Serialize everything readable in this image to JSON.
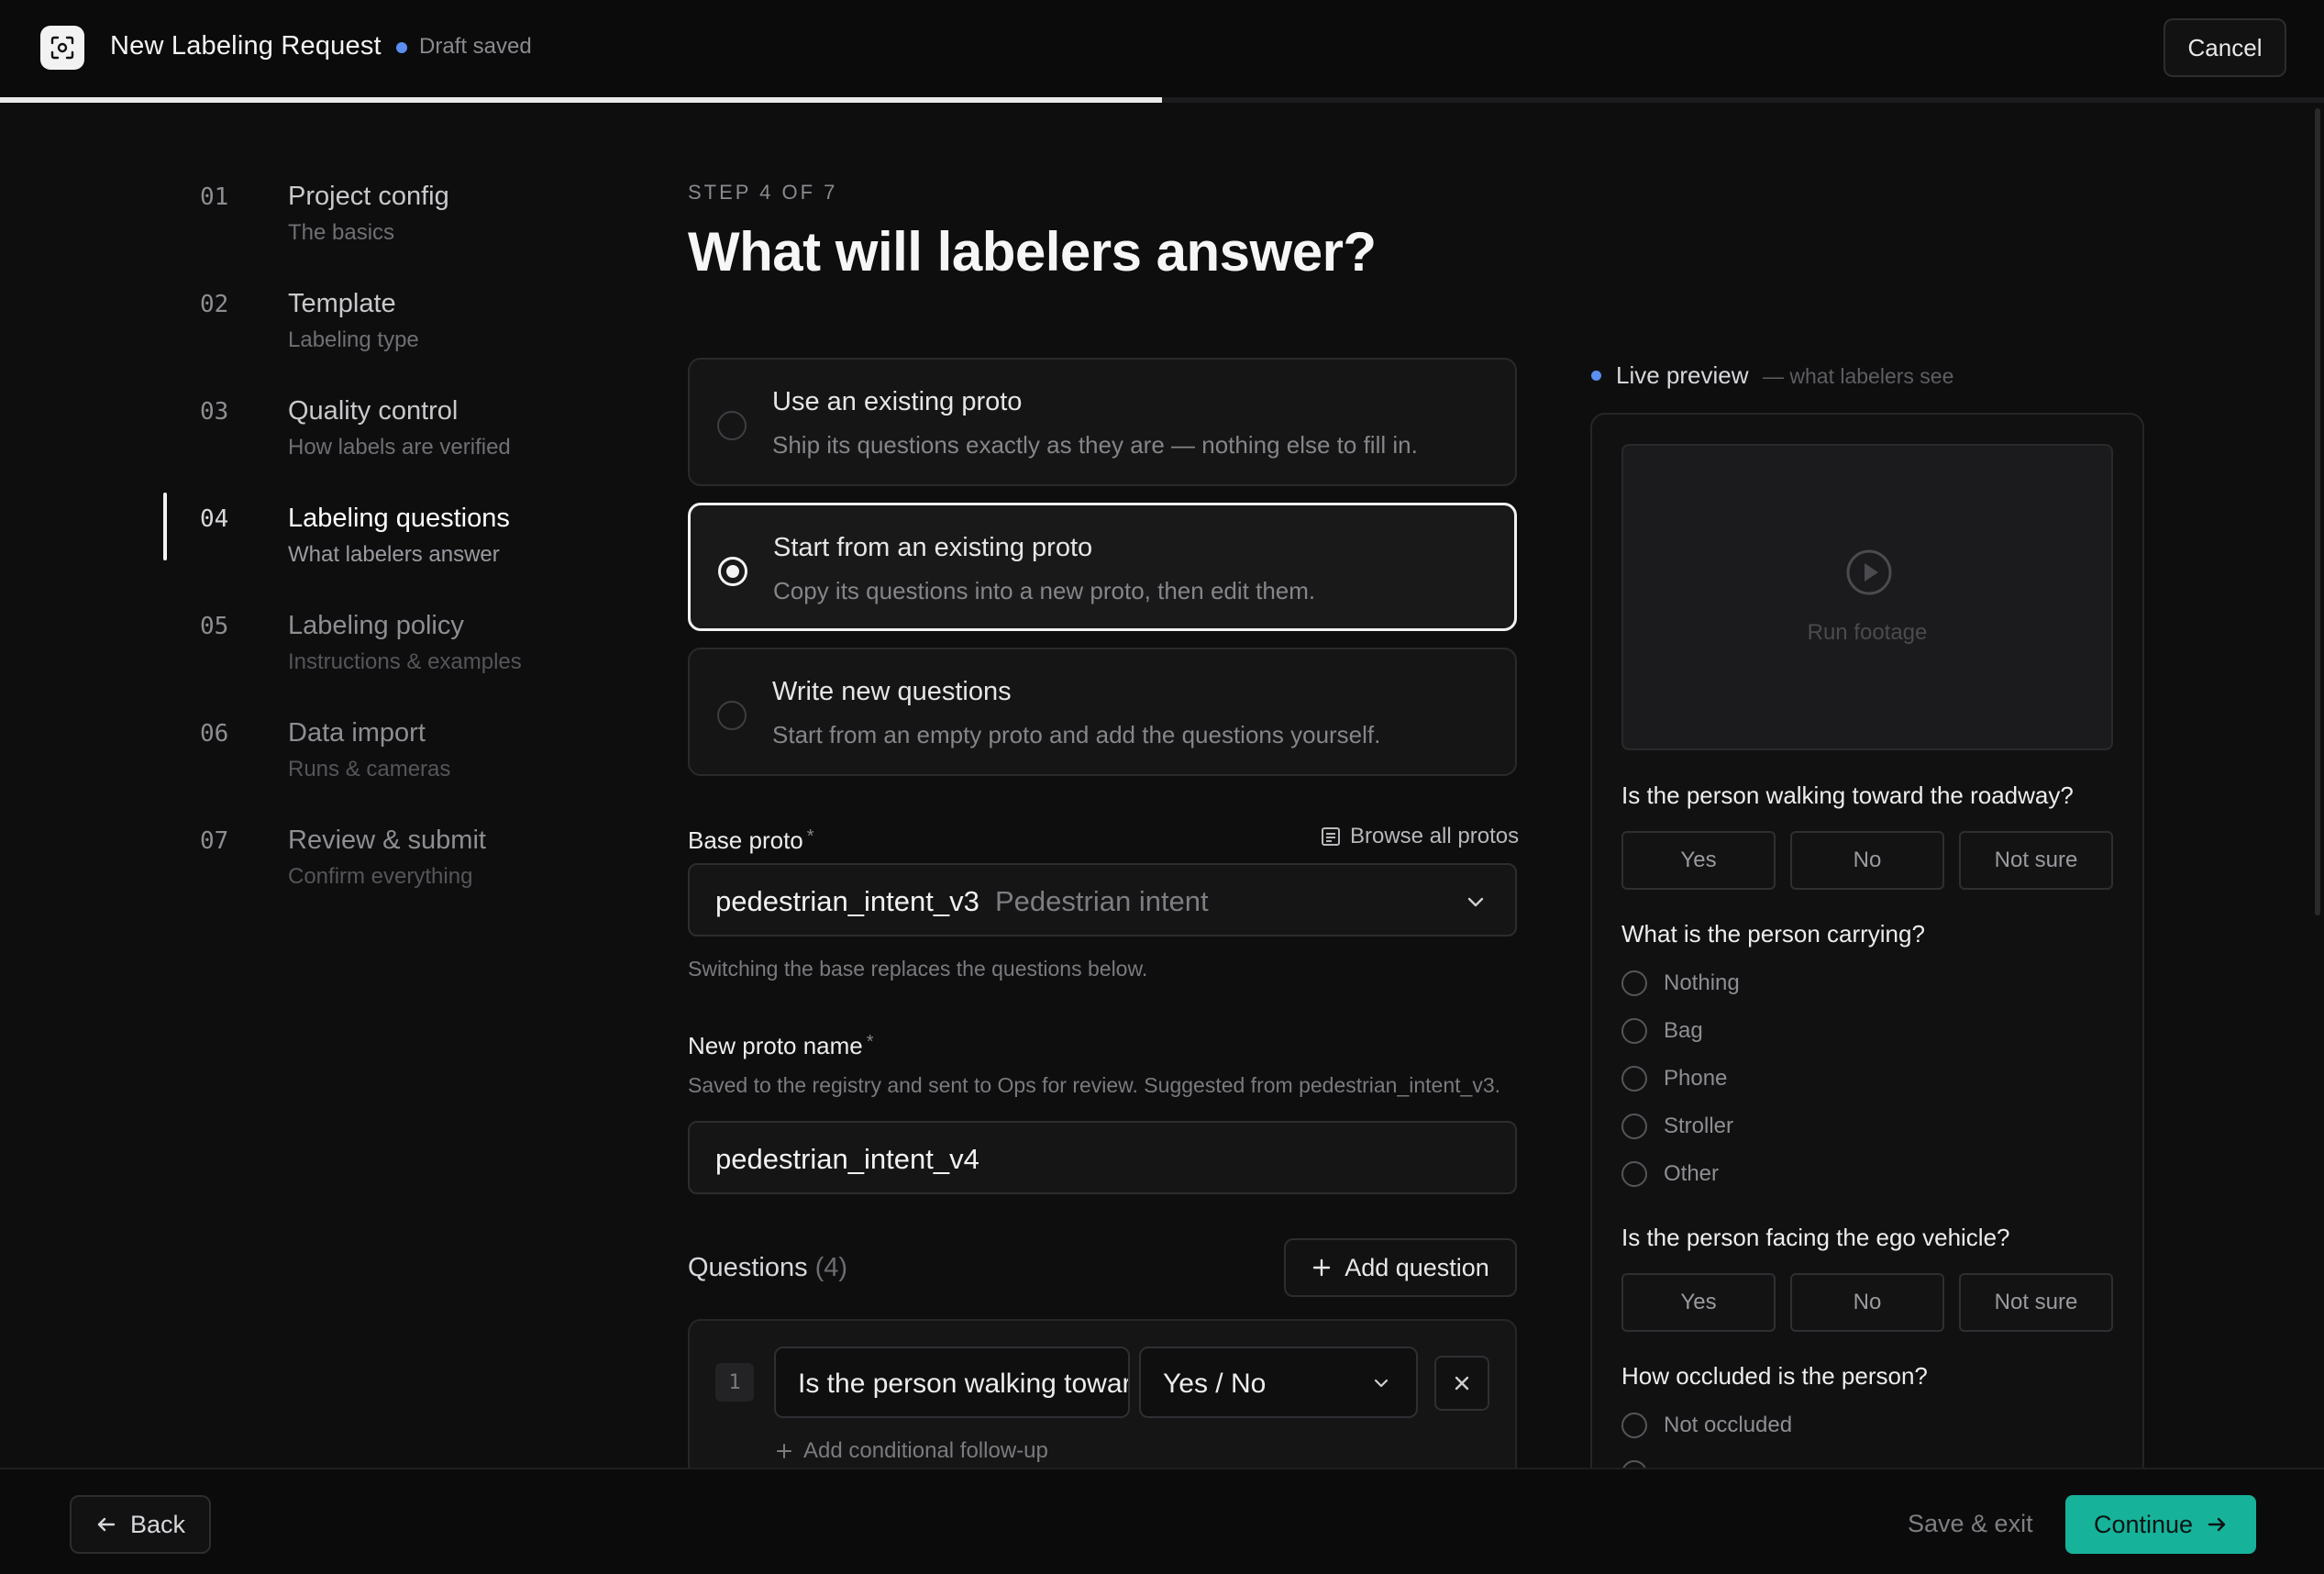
{
  "header": {
    "title": "New Labeling Request",
    "status": "Draft saved",
    "cancel_label": "Cancel",
    "progress": 0.5
  },
  "steps": [
    {
      "num": "01",
      "title": "Project config",
      "sub": "The basics"
    },
    {
      "num": "02",
      "title": "Template",
      "sub": "Labeling type"
    },
    {
      "num": "03",
      "title": "Quality control",
      "sub": "How labels are verified"
    },
    {
      "num": "04",
      "title": "Labeling questions",
      "sub": "What labelers answer"
    },
    {
      "num": "05",
      "title": "Labeling policy",
      "sub": "Instructions & examples"
    },
    {
      "num": "06",
      "title": "Data import",
      "sub": "Runs & cameras"
    },
    {
      "num": "07",
      "title": "Review & submit",
      "sub": "Confirm everything"
    }
  ],
  "main": {
    "step_label": "STEP 4 OF 7",
    "title": "What will labelers answer?",
    "options": [
      {
        "title": "Use an existing proto",
        "desc": "Ship its questions exactly as they are — nothing else to fill in."
      },
      {
        "title": "Start from an existing proto",
        "desc": "Copy its questions into a new proto, then edit them."
      },
      {
        "title": "Write new questions",
        "desc": "Start from an empty proto and add the questions yourself."
      }
    ],
    "base_proto": {
      "label": "Base proto",
      "required": "*",
      "browse_label": "Browse all protos",
      "value": "pedestrian_intent_v3",
      "value_desc": "Pedestrian intent",
      "help": "Switching the base replaces the questions below."
    },
    "new_proto": {
      "label": "New proto name",
      "required": "*",
      "help": "Saved to the registry and sent to Ops for review. Suggested from pedestrian_intent_v3.",
      "value": "pedestrian_intent_v4"
    },
    "questions": {
      "heading": "Questions",
      "count": "(4)",
      "add_label": "Add question",
      "items": [
        {
          "num": "1",
          "text": "Is the person walking toward the roadway?",
          "type": "Yes / No",
          "followup": "Add conditional follow-up"
        }
      ]
    }
  },
  "preview": {
    "title": "Live preview",
    "subtitle": "— what labelers see",
    "video_caption": "Run footage",
    "q1": {
      "text": "Is the person walking toward the roadway?",
      "options": [
        "Yes",
        "No",
        "Not sure"
      ]
    },
    "q2": {
      "text": "What is the person carrying?",
      "options": [
        "Nothing",
        "Bag",
        "Phone",
        "Stroller",
        "Other"
      ]
    },
    "q3": {
      "text": "Is the person facing the ego vehicle?",
      "options": [
        "Yes",
        "No",
        "Not sure"
      ]
    },
    "q4": {
      "text": "How occluded is the person?",
      "options": [
        "Not occluded"
      ]
    }
  },
  "footer": {
    "back_label": "Back",
    "save_exit_label": "Save & exit",
    "continue_label": "Continue"
  },
  "colors": {
    "accent": "#16b39a",
    "status_dot": "#5b8ef0",
    "background": "#0e0e0f"
  }
}
